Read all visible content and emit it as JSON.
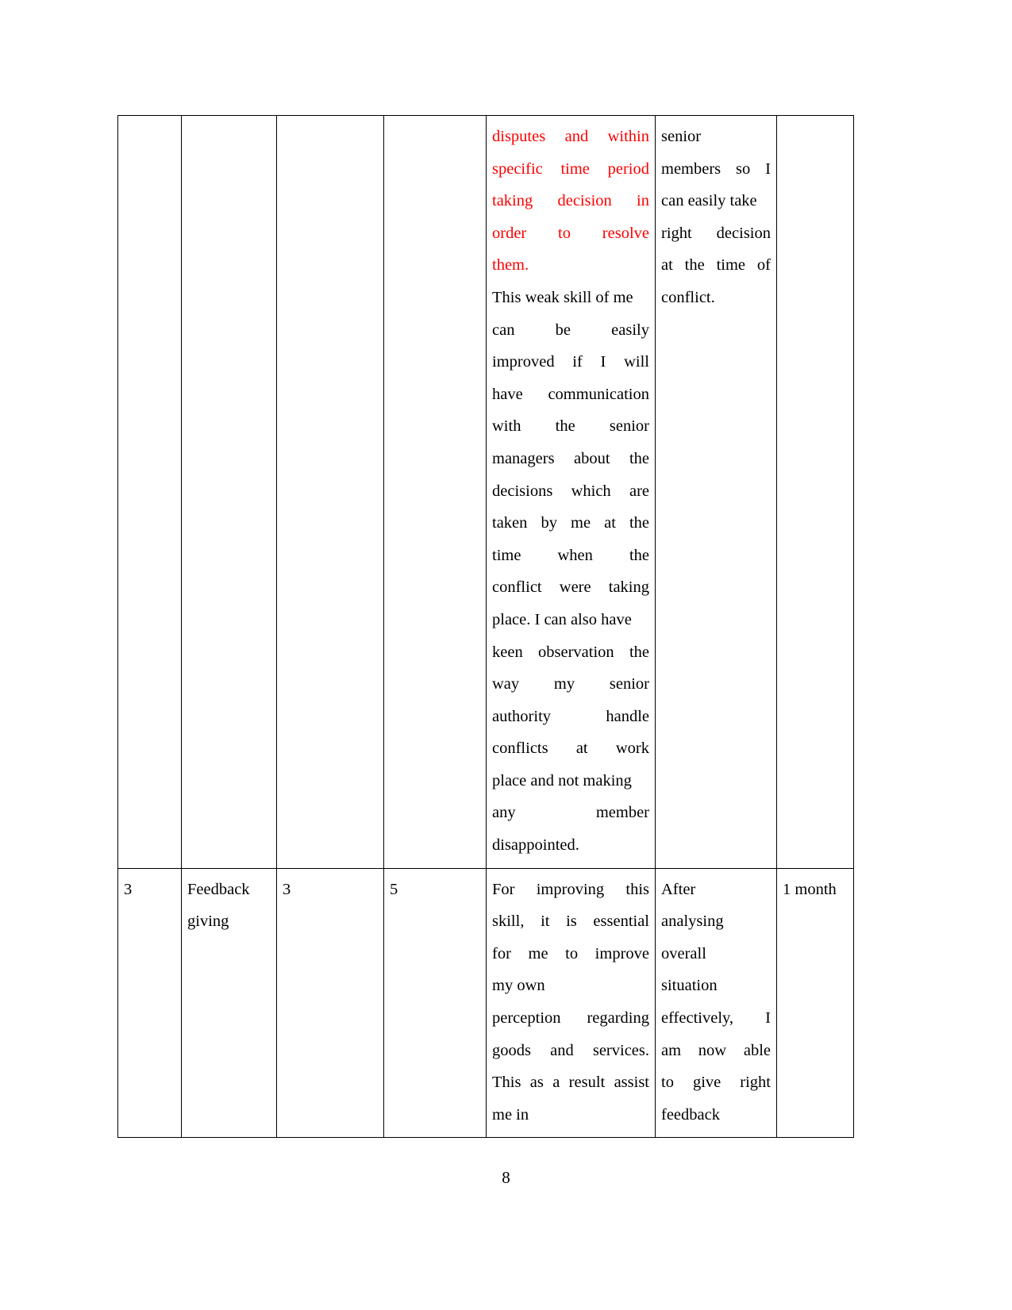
{
  "document": {
    "page_number": "8",
    "accent_red": "#ff0000",
    "text_color": "#000000",
    "background": "#ffffff"
  },
  "table": {
    "rows": [
      {
        "serial_no": "",
        "skill": "",
        "current_proficiency": "",
        "target_proficiency": "",
        "development_opportunities": {
          "red_lines": [
            "disputes and within",
            "specific time period",
            "taking decision in",
            "order to resolve",
            "them."
          ],
          "black_lines": [
            "This weak skill of me",
            "can be easily",
            "improved if I will",
            "have communication",
            "with the senior",
            "managers about the",
            "decisions which are",
            "taken by me at the",
            "time when the",
            "conflict were taking",
            "place. I can also have",
            "keen observation the",
            "way my senior",
            "authority handle",
            "conflicts at work",
            "place and not making",
            "any member",
            "disappointed."
          ]
        },
        "criteria": {
          "lines": [
            "senior",
            "members so I",
            "can easily take",
            "right decision",
            "at the time of",
            "conflict."
          ]
        },
        "time_scale": ""
      },
      {
        "serial_no": "3",
        "skill": "Feedback giving",
        "current_proficiency": "3",
        "target_proficiency": "5",
        "development_opportunities": {
          "red_lines": [],
          "black_lines": [
            "For improving this",
            "skill, it is essential",
            "for me to improve",
            "my own",
            "perception regarding",
            "goods and services.",
            "This as a result assist",
            "me in"
          ]
        },
        "criteria": {
          "lines": [
            "After",
            "analysing",
            "overall",
            "situation",
            "effectively, I",
            "am now able",
            "to give right",
            "feedback"
          ]
        },
        "time_scale": "1 month"
      }
    ]
  }
}
